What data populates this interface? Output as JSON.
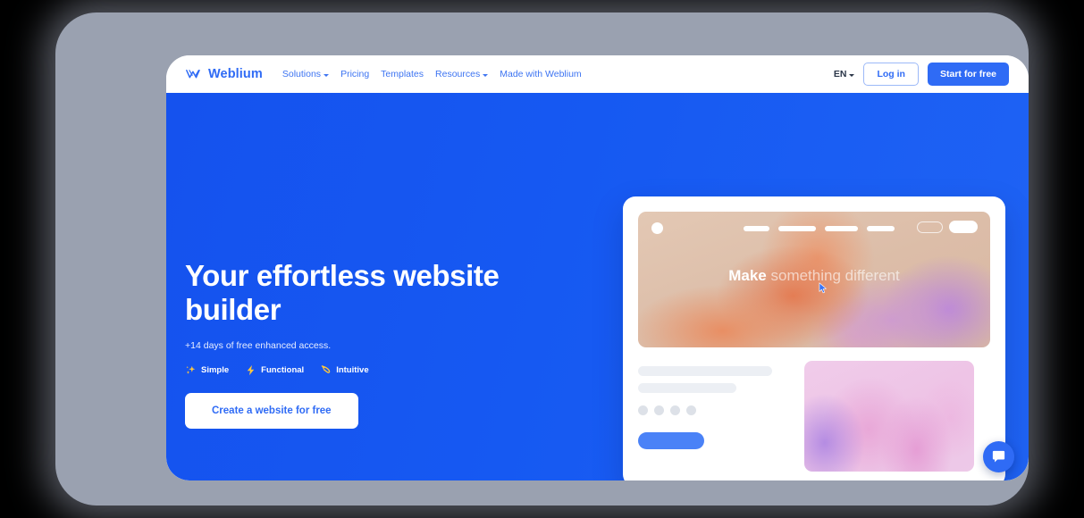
{
  "header": {
    "brand": {
      "name": "Weblium",
      "logo_icon": "weblium-logo-icon"
    },
    "nav": [
      {
        "label": "Solutions",
        "has_dropdown": true
      },
      {
        "label": "Pricing",
        "has_dropdown": false
      },
      {
        "label": "Templates",
        "has_dropdown": false
      },
      {
        "label": "Resources",
        "has_dropdown": true
      },
      {
        "label": "Made with Weblium",
        "has_dropdown": false
      }
    ],
    "language": "EN",
    "login_label": "Log in",
    "start_label": "Start for free"
  },
  "hero": {
    "title": "Your effortless website builder",
    "subtitle": "+14 days of free enhanced access.",
    "badges": [
      {
        "label": "Simple",
        "icon": "sparkles-icon"
      },
      {
        "label": "Functional",
        "icon": "lightning-bolt-icon"
      },
      {
        "label": "Intuitive",
        "icon": "cursor-arrow-icon"
      }
    ],
    "cta_label": "Create a website for free",
    "background_color": "#1552ee"
  },
  "mockup": {
    "banner": {
      "headline_strong": "Make",
      "headline_rest": " something different",
      "nav_pill_widths": [
        29,
        42,
        37,
        31
      ],
      "cursor_icon": "mouse-pointer-icon"
    },
    "body": {
      "skeleton_lines": [
        150,
        110
      ],
      "dot_count": 4,
      "button_present": true
    }
  },
  "chat": {
    "icon": "chat-bubble-icon"
  },
  "colors": {
    "brand_blue": "#2f6bf5",
    "hero_blue": "#1552ee",
    "badge_gold": "#ffc83d",
    "frame_gray": "#9aa1b0",
    "page_white": "#ffffff"
  }
}
